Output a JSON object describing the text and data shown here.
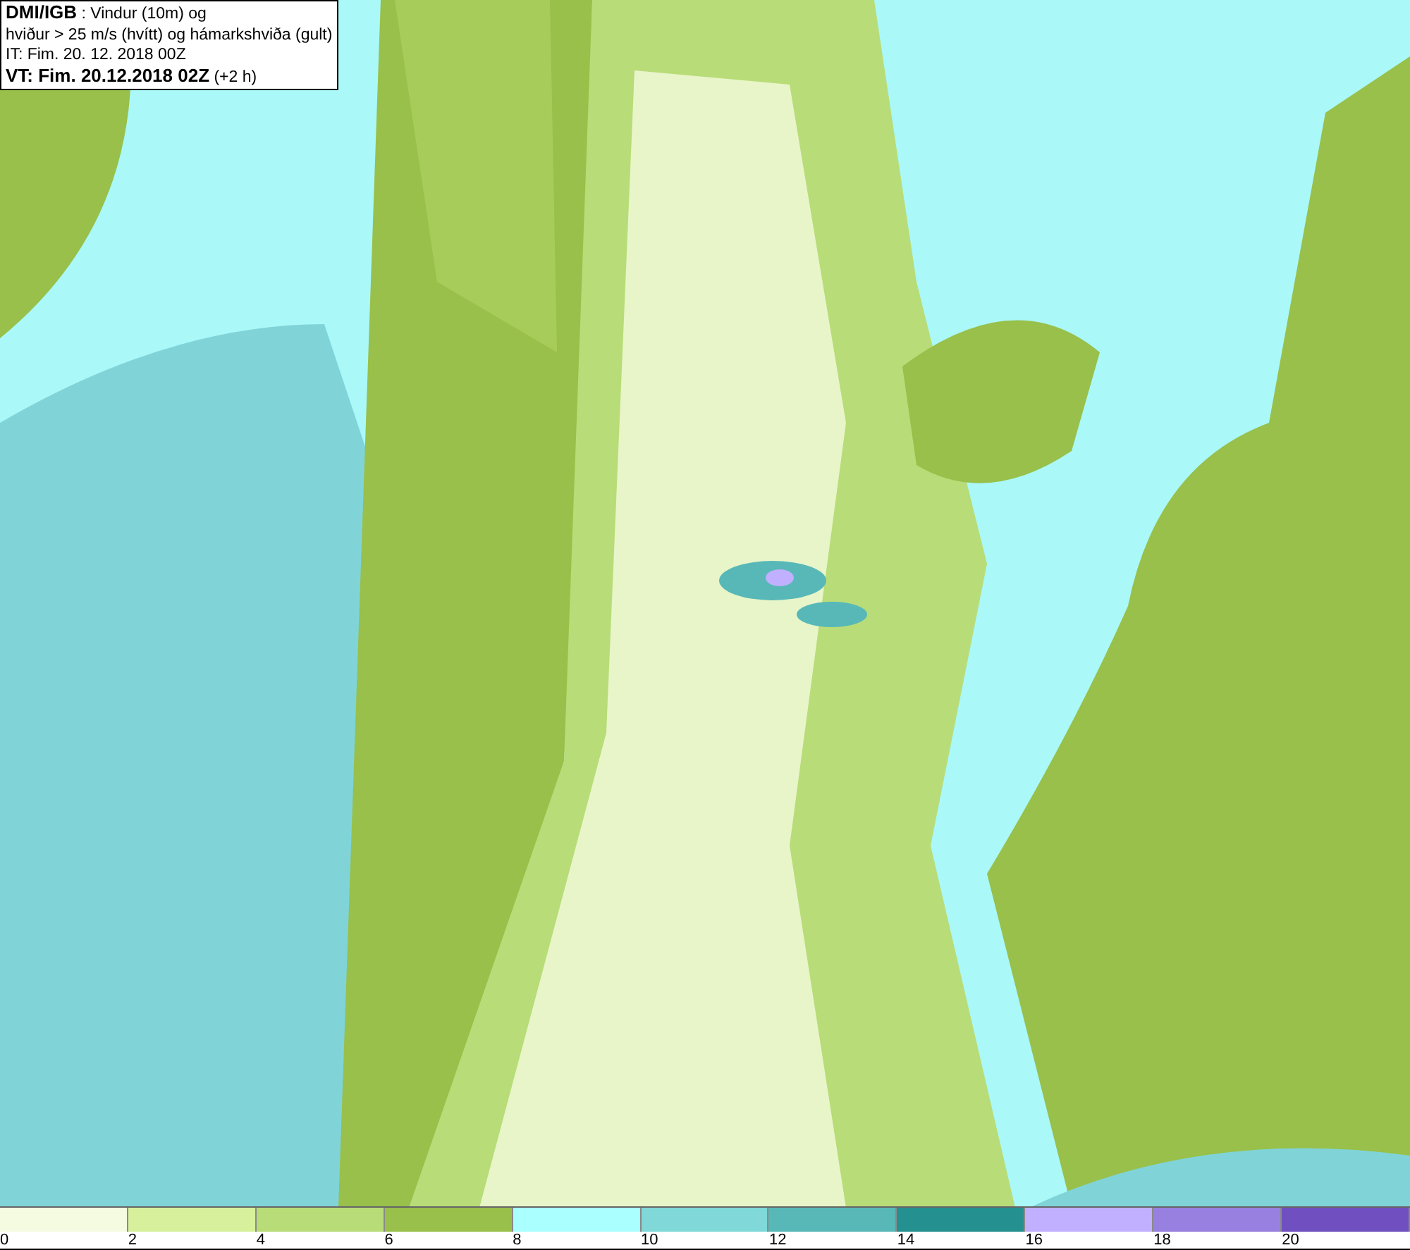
{
  "header": {
    "lines": [
      "**DMI/IGB** : Vindur (10m) og",
      "hviður > 25 m/s (hvítt) og hámarkshviða (gult)",
      "IT: Fim. 20. 12. 2018 00Z",
      "**VT: Fim. 20.12.2018 02Z** (+2 h)"
    ]
  },
  "legend": {
    "bins": [
      {
        "color": "#f4fbe0"
      },
      {
        "color": "#d7f09c"
      },
      {
        "color": "#b8dc78"
      },
      {
        "color": "#98c04a"
      },
      {
        "color": "#aaffff"
      },
      {
        "color": "#80d8d8"
      },
      {
        "color": "#58b8b8"
      },
      {
        "color": "#259090"
      },
      {
        "color": "#c0b0ff"
      },
      {
        "color": "#9880e0"
      },
      {
        "color": "#7050c0"
      }
    ],
    "ticks": [
      "0",
      "2",
      "4",
      "6",
      "8",
      "10",
      "12",
      "14",
      "16",
      "18",
      "20"
    ]
  }
}
